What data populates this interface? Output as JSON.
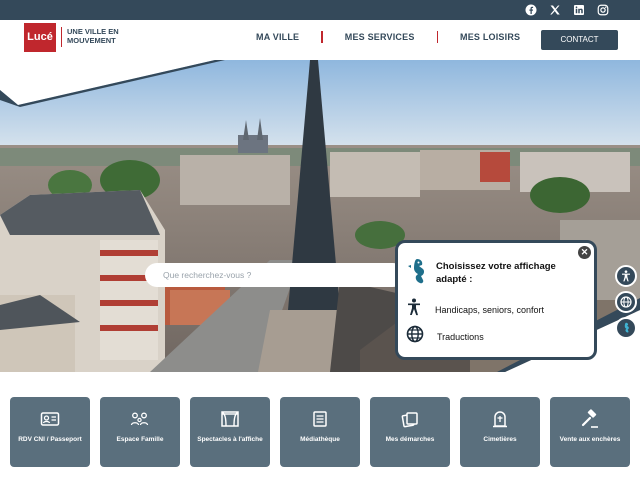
{
  "header": {
    "logo_text": "Lucé",
    "tagline": "UNE VILLE EN MOUVEMENT",
    "nav": [
      {
        "label": "MA VILLE"
      },
      {
        "label": "MES SERVICES"
      },
      {
        "label": "MES LOISIRS"
      }
    ],
    "contact_label": "CONTACT"
  },
  "social": [
    "facebook-icon",
    "x-icon",
    "linkedin-icon",
    "instagram-icon"
  ],
  "search": {
    "placeholder": "Que recherchez-vous ?"
  },
  "accessibility_popup": {
    "title": "Choisissez votre affichage adapté :",
    "options": [
      {
        "icon": "person-icon",
        "label": "Handicaps, seniors, confort"
      },
      {
        "icon": "globe-icon",
        "label": "Traductions"
      }
    ]
  },
  "side_buttons": [
    "accessibility-icon",
    "globe-icon",
    "seahorse-icon"
  ],
  "tiles": [
    {
      "icon": "id-card-icon",
      "label": "RDV CNI / Passeport"
    },
    {
      "icon": "family-icon",
      "label": "Espace Famille"
    },
    {
      "icon": "theater-icon",
      "label": "Spectacles à l'affiche"
    },
    {
      "icon": "books-icon",
      "label": "Médiathèque"
    },
    {
      "icon": "documents-icon",
      "label": "Mes démarches"
    },
    {
      "icon": "tombstone-icon",
      "label": "Cimetières"
    },
    {
      "icon": "gavel-icon",
      "label": "Vente aux enchères"
    }
  ],
  "colors": {
    "brand_red": "#c0272d",
    "navy": "#34495a",
    "tile": "#5a6f7d"
  }
}
